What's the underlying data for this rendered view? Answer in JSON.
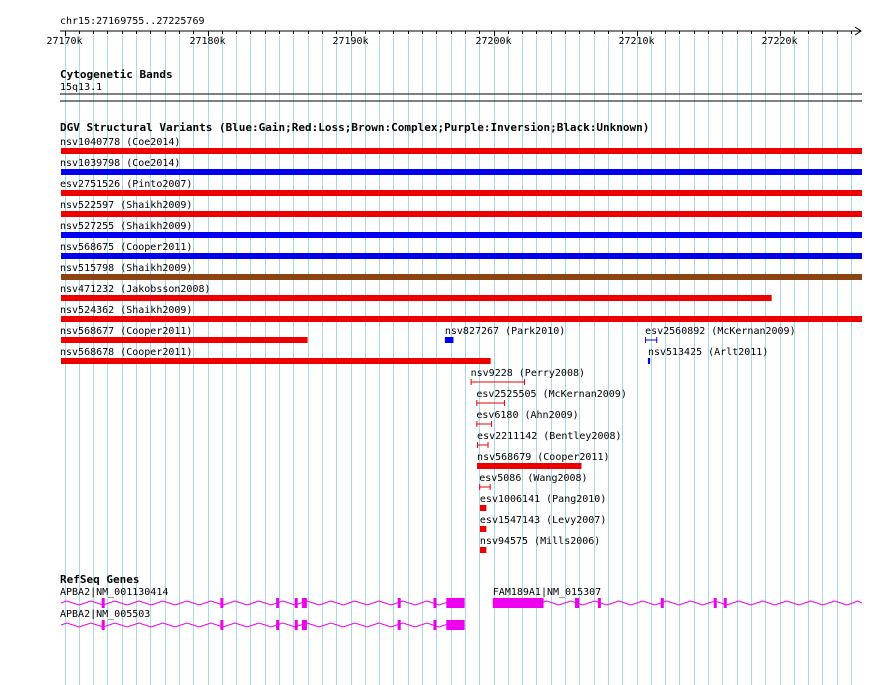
{
  "region": {
    "label": "chr15:27169755..27225769",
    "start": 27169755,
    "end": 27225769,
    "tick_step": 10000,
    "minor_tick_step": 1000,
    "ticks": [
      {
        "pos": 27170000,
        "label": "27170k"
      },
      {
        "pos": 27180000,
        "label": "27180k"
      },
      {
        "pos": 27190000,
        "label": "27190k"
      },
      {
        "pos": 27200000,
        "label": "27200k"
      },
      {
        "pos": 27210000,
        "label": "27210k"
      },
      {
        "pos": 27220000,
        "label": "27220k"
      }
    ]
  },
  "colors": {
    "gain": "#0000ee",
    "loss": "#ee0000",
    "complex": "#8b4513",
    "gene": "#ee00ee",
    "grid": "#a8d8e8",
    "text": "#000000"
  },
  "tracks": {
    "cytoband": {
      "title": "Cytogenetic Bands",
      "band": "15q13.1"
    },
    "dgv": {
      "title": "DGV Structural Variants (Blue:Gain;Red:Loss;Brown:Complex;Purple:Inversion;Black:Unknown)",
      "variants": [
        {
          "label": "nsv1040778 (Coe2014)",
          "start": 27169755,
          "end": 27225769,
          "type": "loss",
          "style": "bar",
          "row": 0
        },
        {
          "label": "nsv1039798 (Coe2014)",
          "start": 27169755,
          "end": 27225769,
          "type": "gain",
          "style": "bar",
          "row": 1
        },
        {
          "label": "esv2751526 (Pinto2007)",
          "start": 27169755,
          "end": 27225769,
          "type": "loss",
          "style": "bar",
          "row": 2
        },
        {
          "label": "nsv522597 (Shaikh2009)",
          "start": 27169755,
          "end": 27225769,
          "type": "loss",
          "style": "bar",
          "row": 3
        },
        {
          "label": "nsv527255 (Shaikh2009)",
          "start": 27169755,
          "end": 27225769,
          "type": "gain",
          "style": "bar",
          "row": 4
        },
        {
          "label": "nsv568675 (Cooper2011)",
          "start": 27169755,
          "end": 27225769,
          "type": "gain",
          "style": "bar",
          "row": 5
        },
        {
          "label": "nsv515798 (Shaikh2009)",
          "start": 27169755,
          "end": 27225769,
          "type": "complex",
          "style": "bar",
          "row": 6
        },
        {
          "label": "nsv471232 (Jakobsson2008)",
          "start": 27169755,
          "end": 27219450,
          "type": "loss",
          "style": "bar",
          "row": 7
        },
        {
          "label": "nsv524362 (Shaikh2009)",
          "start": 27169755,
          "end": 27225769,
          "type": "loss",
          "style": "bar",
          "row": 8
        },
        {
          "label": "nsv568677 (Cooper2011)",
          "start": 27169755,
          "end": 27187000,
          "type": "loss",
          "style": "bar",
          "row": 9
        },
        {
          "label": "nsv827267 (Park2010)",
          "start": 27196600,
          "end": 27197200,
          "type": "gain",
          "style": "bar",
          "row": 9
        },
        {
          "label": "esv2560892 (McKernan2009)",
          "start": 27210600,
          "end": 27211450,
          "type": "gain",
          "style": "bracket",
          "row": 9
        },
        {
          "label": "nsv568678 (Cooper2011)",
          "start": 27169755,
          "end": 27199800,
          "type": "loss",
          "style": "bar",
          "row": 10
        },
        {
          "label": "nsv513425 (Arlt2011)",
          "start": 27210800,
          "end": 27210950,
          "type": "gain",
          "style": "bar",
          "row": 10
        },
        {
          "label": "nsv9228 (Perry2008)",
          "start": 27198400,
          "end": 27202200,
          "type": "loss",
          "style": "bracket",
          "row": 11
        },
        {
          "label": "esv2525505 (McKernan2009)",
          "start": 27198800,
          "end": 27200800,
          "type": "loss",
          "style": "bracket",
          "row": 12
        },
        {
          "label": "esv6180 (Ahn2009)",
          "start": 27198800,
          "end": 27199900,
          "type": "loss",
          "style": "bracket",
          "row": 13
        },
        {
          "label": "esv2211142 (Bentley2008)",
          "start": 27198850,
          "end": 27199650,
          "type": "loss",
          "style": "bracket",
          "row": 14
        },
        {
          "label": "nsv568679 (Cooper2011)",
          "start": 27198850,
          "end": 27206150,
          "type": "loss",
          "style": "bar",
          "row": 15
        },
        {
          "label": "esv5086 (Wang2008)",
          "start": 27199000,
          "end": 27199800,
          "type": "loss",
          "style": "bracket",
          "row": 16
        },
        {
          "label": "esv1006141 (Pang2010)",
          "start": 27199050,
          "end": 27199500,
          "type": "loss",
          "style": "bar",
          "row": 17
        },
        {
          "label": "esv1547143 (Levy2007)",
          "start": 27199050,
          "end": 27199500,
          "type": "loss",
          "style": "bar",
          "row": 18
        },
        {
          "label": "nsv94575 (Mills2006)",
          "start": 27199050,
          "end": 27199500,
          "type": "loss",
          "style": "bar",
          "row": 19
        }
      ]
    },
    "refseq": {
      "title": "RefSeq Genes",
      "genes": [
        {
          "label": "APBA2|NM_001130414",
          "start": 27169755,
          "end": 27197980,
          "row": 0,
          "exons": [
            [
              27172600,
              27172800
            ],
            [
              27180900,
              27181100
            ],
            [
              27184800,
              27185000
            ],
            [
              27186100,
              27186300
            ],
            [
              27186600,
              27186950
            ],
            [
              27193300,
              27193500
            ],
            [
              27195800,
              27196000
            ],
            [
              27196700,
              27197980
            ]
          ]
        },
        {
          "label": "FAM189A1|NM_015307",
          "start": 27199950,
          "end": 27225769,
          "row": 0,
          "exons": [
            [
              27199950,
              27203500
            ],
            [
              27205700,
              27206000
            ],
            [
              27207300,
              27207500
            ],
            [
              27211700,
              27211900
            ],
            [
              27215400,
              27215600
            ],
            [
              27216100,
              27216300
            ]
          ]
        },
        {
          "label": "APBA2|NM_005503",
          "start": 27169755,
          "end": 27197980,
          "row": 1,
          "exons": [
            [
              27172600,
              27172800
            ],
            [
              27180900,
              27181100
            ],
            [
              27184800,
              27185000
            ],
            [
              27186100,
              27186300
            ],
            [
              27186600,
              27186950
            ],
            [
              27193300,
              27193500
            ],
            [
              27195800,
              27196000
            ],
            [
              27196700,
              27197980
            ]
          ]
        }
      ]
    }
  }
}
